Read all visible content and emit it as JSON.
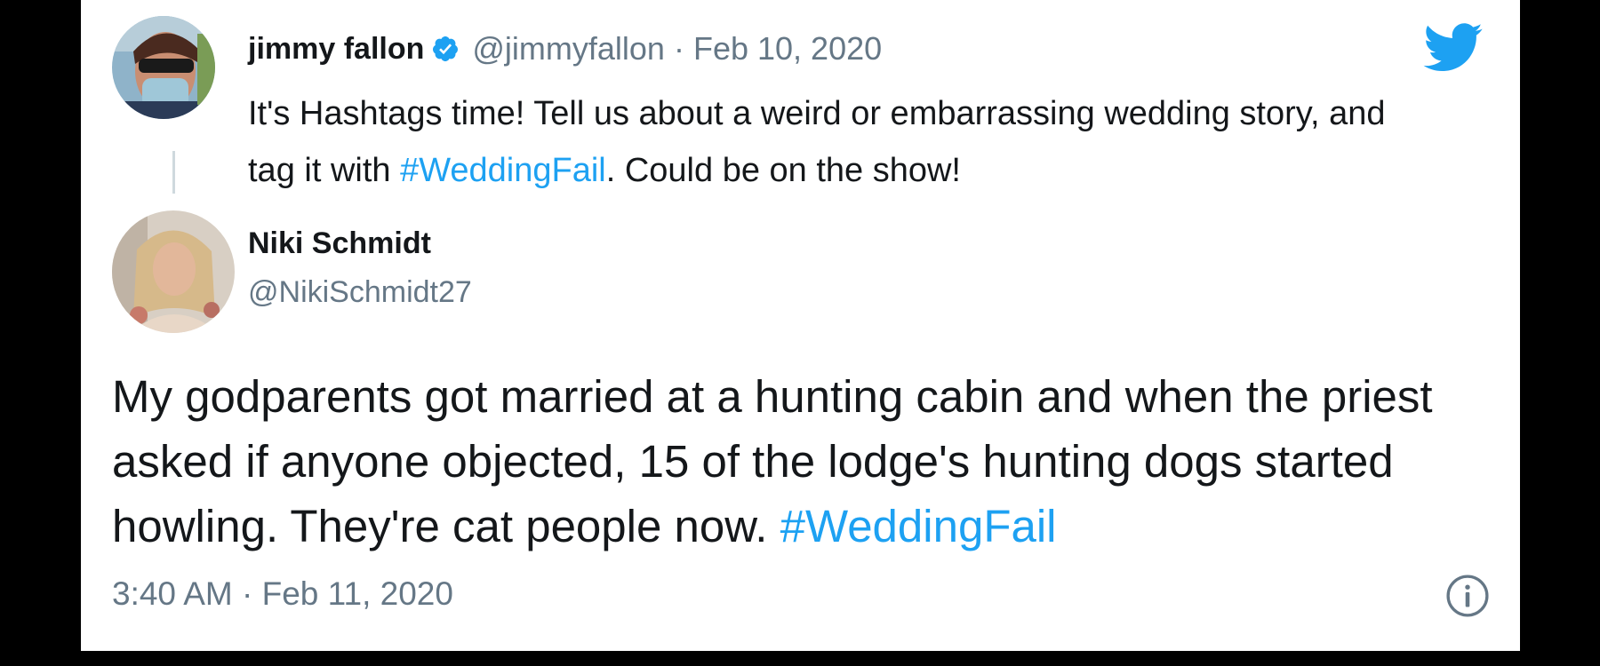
{
  "quoted_tweet": {
    "author_name": "jimmy fallon",
    "handle": "@jimmyfallon",
    "separator": "·",
    "date": "Feb 10, 2020",
    "text_before": "It's Hashtags time! Tell us about a weird or embarrassing wedding story, and tag it with ",
    "hashtag": "#WeddingFail",
    "text_after": ". Could be on the show!"
  },
  "reply_tweet": {
    "author_name": "Niki Schmidt",
    "handle": "@NikiSchmidt27",
    "text_before": "My godparents got married at a hunting cabin and when the priest asked if anyone objected, 15 of the lodge's hunting dogs started howling. They're cat people now. ",
    "hashtag": "#WeddingFail",
    "timestamp": "3:40 AM · Feb 11, 2020"
  },
  "icons": {
    "brand": "twitter-bird-icon",
    "verified": "verified-badge-icon",
    "info": "info-icon"
  },
  "colors": {
    "accent": "#1da1f2",
    "text": "#14171a",
    "secondary_text": "#657786",
    "background": "#000000",
    "card": "#ffffff"
  }
}
